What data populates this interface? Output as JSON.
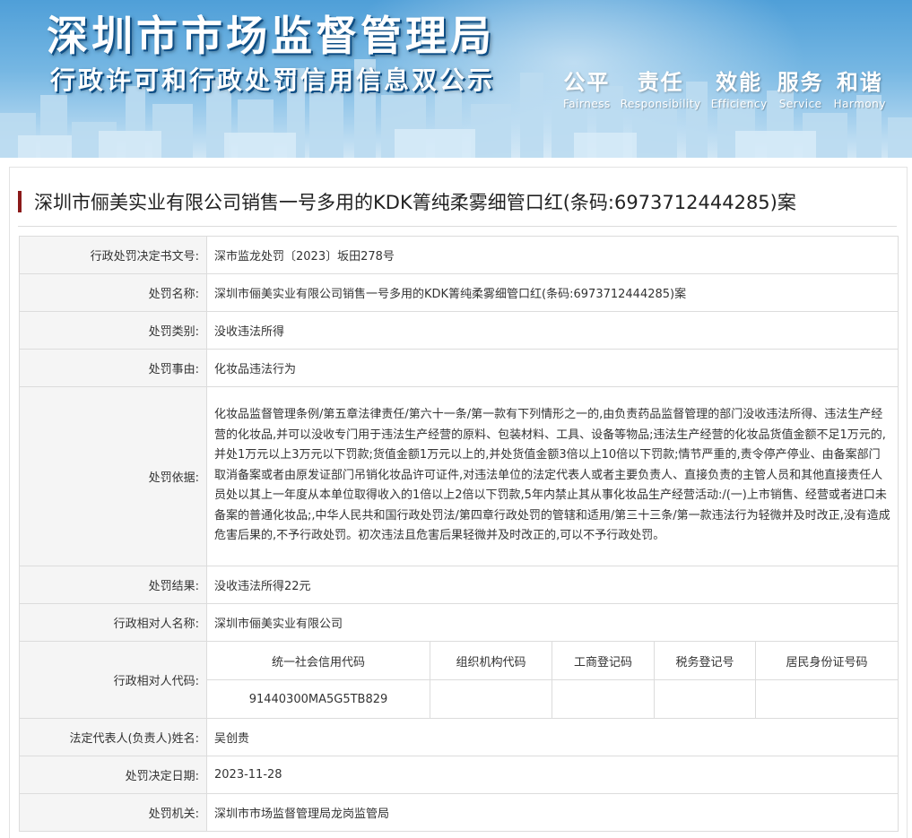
{
  "banner": {
    "title_main": "深圳市市场监督管理局",
    "title_sub": "行政许可和行政处罚信用信息双公示",
    "mottos": [
      {
        "cn": "公平",
        "en": "Fairness"
      },
      {
        "cn": "责任",
        "en": "Responsibility"
      },
      {
        "cn": "效能",
        "en": "Efficiency"
      },
      {
        "cn": "服务",
        "en": "Service"
      },
      {
        "cn": "和谐",
        "en": "Harmony"
      }
    ]
  },
  "case": {
    "title": "深圳市俪美实业有限公司销售一号多用的KDK箐纯柔雾细管口红(条码:6973712444285)案"
  },
  "table": {
    "rows": [
      {
        "label": "行政处罚决定书文号:",
        "value": "深市监龙处罚〔2023〕坂田278号"
      },
      {
        "label": "处罚名称:",
        "value": "深圳市俪美实业有限公司销售一号多用的KDK箐纯柔雾细管口红(条码:6973712444285)案"
      },
      {
        "label": "处罚类别:",
        "value": "没收违法所得"
      },
      {
        "label": "处罚事由:",
        "value": "化妆品违法行为"
      }
    ],
    "basis": {
      "label": "处罚依据:",
      "value": "化妆品监督管理条例/第五章法律责任/第六十一条/第一款有下列情形之一的,由负责药品监督管理的部门没收违法所得、违法生产经营的化妆品,并可以没收专门用于违法生产经营的原料、包装材料、工具、设备等物品;违法生产经营的化妆品货值金额不足1万元的,并处1万元以上3万元以下罚款;货值金额1万元以上的,并处货值金额3倍以上10倍以下罚款;情节严重的,责令停产停业、由备案部门取消备案或者由原发证部门吊销化妆品许可证件,对违法单位的法定代表人或者主要负责人、直接负责的主管人员和其他直接责任人员处以其上一年度从本单位取得收入的1倍以上2倍以下罚款,5年内禁止其从事化妆品生产经营活动:/(一)上市销售、经营或者进口未备案的普通化妆品;,中华人民共和国行政处罚法/第四章行政处罚的管辖和适用/第三十三条/第一款违法行为轻微并及时改正,没有造成危害后果的,不予行政处罚。初次违法且危害后果轻微并及时改正的,可以不予行政处罚。"
    },
    "result": {
      "label": "处罚结果:",
      "value": "没收违法所得22元"
    },
    "party_name": {
      "label": "行政相对人名称:",
      "value": "深圳市俪美实业有限公司"
    },
    "party_code": {
      "label": "行政相对人代码:",
      "headers": [
        "统一社会信用代码",
        "组织机构代码",
        "工商登记码",
        "税务登记号",
        "居民身份证号码"
      ],
      "values": [
        "91440300MA5G5TB829",
        "",
        "",
        "",
        ""
      ]
    },
    "tail_rows": [
      {
        "label": "法定代表人(负责人)姓名:",
        "value": "吴创贵"
      },
      {
        "label": "处罚决定日期:",
        "value": "2023-11-28"
      },
      {
        "label": "处罚机关:",
        "value": "深圳市市场监督管理局龙岗监管局"
      }
    ]
  }
}
